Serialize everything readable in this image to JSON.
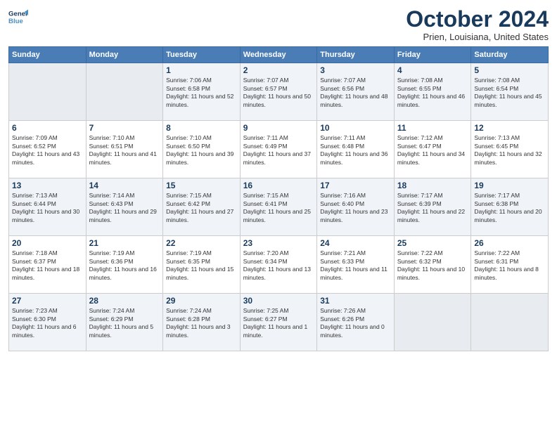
{
  "header": {
    "logo_line1": "General",
    "logo_line2": "Blue",
    "month": "October 2024",
    "location": "Prien, Louisiana, United States"
  },
  "days_of_week": [
    "Sunday",
    "Monday",
    "Tuesday",
    "Wednesday",
    "Thursday",
    "Friday",
    "Saturday"
  ],
  "weeks": [
    [
      {
        "day": "",
        "sunrise": "",
        "sunset": "",
        "daylight": ""
      },
      {
        "day": "",
        "sunrise": "",
        "sunset": "",
        "daylight": ""
      },
      {
        "day": "1",
        "sunrise": "Sunrise: 7:06 AM",
        "sunset": "Sunset: 6:58 PM",
        "daylight": "Daylight: 11 hours and 52 minutes."
      },
      {
        "day": "2",
        "sunrise": "Sunrise: 7:07 AM",
        "sunset": "Sunset: 6:57 PM",
        "daylight": "Daylight: 11 hours and 50 minutes."
      },
      {
        "day": "3",
        "sunrise": "Sunrise: 7:07 AM",
        "sunset": "Sunset: 6:56 PM",
        "daylight": "Daylight: 11 hours and 48 minutes."
      },
      {
        "day": "4",
        "sunrise": "Sunrise: 7:08 AM",
        "sunset": "Sunset: 6:55 PM",
        "daylight": "Daylight: 11 hours and 46 minutes."
      },
      {
        "day": "5",
        "sunrise": "Sunrise: 7:08 AM",
        "sunset": "Sunset: 6:54 PM",
        "daylight": "Daylight: 11 hours and 45 minutes."
      }
    ],
    [
      {
        "day": "6",
        "sunrise": "Sunrise: 7:09 AM",
        "sunset": "Sunset: 6:52 PM",
        "daylight": "Daylight: 11 hours and 43 minutes."
      },
      {
        "day": "7",
        "sunrise": "Sunrise: 7:10 AM",
        "sunset": "Sunset: 6:51 PM",
        "daylight": "Daylight: 11 hours and 41 minutes."
      },
      {
        "day": "8",
        "sunrise": "Sunrise: 7:10 AM",
        "sunset": "Sunset: 6:50 PM",
        "daylight": "Daylight: 11 hours and 39 minutes."
      },
      {
        "day": "9",
        "sunrise": "Sunrise: 7:11 AM",
        "sunset": "Sunset: 6:49 PM",
        "daylight": "Daylight: 11 hours and 37 minutes."
      },
      {
        "day": "10",
        "sunrise": "Sunrise: 7:11 AM",
        "sunset": "Sunset: 6:48 PM",
        "daylight": "Daylight: 11 hours and 36 minutes."
      },
      {
        "day": "11",
        "sunrise": "Sunrise: 7:12 AM",
        "sunset": "Sunset: 6:47 PM",
        "daylight": "Daylight: 11 hours and 34 minutes."
      },
      {
        "day": "12",
        "sunrise": "Sunrise: 7:13 AM",
        "sunset": "Sunset: 6:45 PM",
        "daylight": "Daylight: 11 hours and 32 minutes."
      }
    ],
    [
      {
        "day": "13",
        "sunrise": "Sunrise: 7:13 AM",
        "sunset": "Sunset: 6:44 PM",
        "daylight": "Daylight: 11 hours and 30 minutes."
      },
      {
        "day": "14",
        "sunrise": "Sunrise: 7:14 AM",
        "sunset": "Sunset: 6:43 PM",
        "daylight": "Daylight: 11 hours and 29 minutes."
      },
      {
        "day": "15",
        "sunrise": "Sunrise: 7:15 AM",
        "sunset": "Sunset: 6:42 PM",
        "daylight": "Daylight: 11 hours and 27 minutes."
      },
      {
        "day": "16",
        "sunrise": "Sunrise: 7:15 AM",
        "sunset": "Sunset: 6:41 PM",
        "daylight": "Daylight: 11 hours and 25 minutes."
      },
      {
        "day": "17",
        "sunrise": "Sunrise: 7:16 AM",
        "sunset": "Sunset: 6:40 PM",
        "daylight": "Daylight: 11 hours and 23 minutes."
      },
      {
        "day": "18",
        "sunrise": "Sunrise: 7:17 AM",
        "sunset": "Sunset: 6:39 PM",
        "daylight": "Daylight: 11 hours and 22 minutes."
      },
      {
        "day": "19",
        "sunrise": "Sunrise: 7:17 AM",
        "sunset": "Sunset: 6:38 PM",
        "daylight": "Daylight: 11 hours and 20 minutes."
      }
    ],
    [
      {
        "day": "20",
        "sunrise": "Sunrise: 7:18 AM",
        "sunset": "Sunset: 6:37 PM",
        "daylight": "Daylight: 11 hours and 18 minutes."
      },
      {
        "day": "21",
        "sunrise": "Sunrise: 7:19 AM",
        "sunset": "Sunset: 6:36 PM",
        "daylight": "Daylight: 11 hours and 16 minutes."
      },
      {
        "day": "22",
        "sunrise": "Sunrise: 7:19 AM",
        "sunset": "Sunset: 6:35 PM",
        "daylight": "Daylight: 11 hours and 15 minutes."
      },
      {
        "day": "23",
        "sunrise": "Sunrise: 7:20 AM",
        "sunset": "Sunset: 6:34 PM",
        "daylight": "Daylight: 11 hours and 13 minutes."
      },
      {
        "day": "24",
        "sunrise": "Sunrise: 7:21 AM",
        "sunset": "Sunset: 6:33 PM",
        "daylight": "Daylight: 11 hours and 11 minutes."
      },
      {
        "day": "25",
        "sunrise": "Sunrise: 7:22 AM",
        "sunset": "Sunset: 6:32 PM",
        "daylight": "Daylight: 11 hours and 10 minutes."
      },
      {
        "day": "26",
        "sunrise": "Sunrise: 7:22 AM",
        "sunset": "Sunset: 6:31 PM",
        "daylight": "Daylight: 11 hours and 8 minutes."
      }
    ],
    [
      {
        "day": "27",
        "sunrise": "Sunrise: 7:23 AM",
        "sunset": "Sunset: 6:30 PM",
        "daylight": "Daylight: 11 hours and 6 minutes."
      },
      {
        "day": "28",
        "sunrise": "Sunrise: 7:24 AM",
        "sunset": "Sunset: 6:29 PM",
        "daylight": "Daylight: 11 hours and 5 minutes."
      },
      {
        "day": "29",
        "sunrise": "Sunrise: 7:24 AM",
        "sunset": "Sunset: 6:28 PM",
        "daylight": "Daylight: 11 hours and 3 minutes."
      },
      {
        "day": "30",
        "sunrise": "Sunrise: 7:25 AM",
        "sunset": "Sunset: 6:27 PM",
        "daylight": "Daylight: 11 hours and 1 minute."
      },
      {
        "day": "31",
        "sunrise": "Sunrise: 7:26 AM",
        "sunset": "Sunset: 6:26 PM",
        "daylight": "Daylight: 11 hours and 0 minutes."
      },
      {
        "day": "",
        "sunrise": "",
        "sunset": "",
        "daylight": ""
      },
      {
        "day": "",
        "sunrise": "",
        "sunset": "",
        "daylight": ""
      }
    ]
  ]
}
